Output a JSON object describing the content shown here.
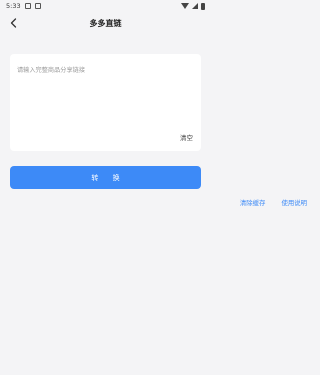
{
  "status_bar": {
    "time": "5:33"
  },
  "header": {
    "title": "多多直链"
  },
  "input": {
    "placeholder": "请输入完整商品分享链接",
    "clear_label": "清空"
  },
  "actions": {
    "convert_label": "转 换",
    "clear_cache_label": "清除缓存",
    "help_label": "使用说明"
  },
  "colors": {
    "accent": "#3d8af7",
    "background": "#f4f4f6"
  }
}
